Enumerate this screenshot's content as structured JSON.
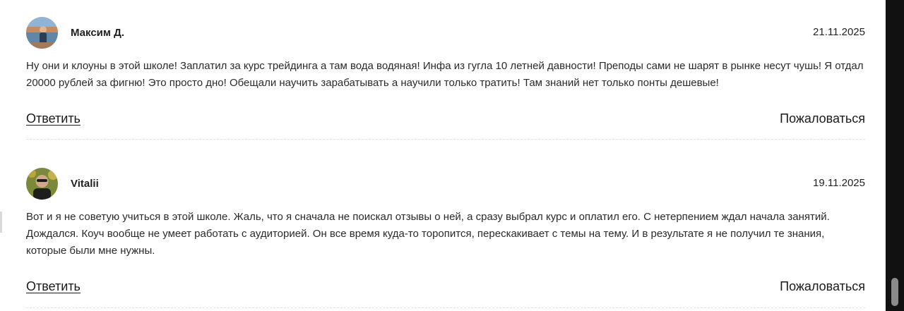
{
  "reviews": [
    {
      "author": "Максим Д.",
      "date": "21.11.2025",
      "text": "Ну они и клоуны в этой школе! Заплатил за курс трейдинга а там вода водяная! Инфа из гугла 10 летней давности! Преподы сами не шарят в рынке несут чушь! Я отдал 20000 рублей за фигню! Это просто дно! Обещали научить зарабатывать а научили только тратить! Там знаний нет только понты дешевые!",
      "reply_label": "Ответить",
      "report_label": "Пожаловаться",
      "avatar": "photo-avatar-landscape"
    },
    {
      "author": "Vitalii",
      "date": "19.11.2025",
      "text": "Вот и я не советую учиться в этой школе. Жаль, что я сначала не поискал отзывы о ней, а сразу выбрал курс и оплатил его. С нетерпением ждал начала занятий. Дождался. Коуч вообще не умеет работать с аудиторией. Он все время куда-то торопится, перескакивает с темы на тему. И в результате я не получил те знания, которые были мне нужны.",
      "reply_label": "Ответить",
      "report_label": "Пожаловаться",
      "avatar": "photo-avatar-sunglasses"
    }
  ],
  "colors": {
    "text": "#2a2a2a",
    "divider": "#e2e2e2",
    "scrollbar": "#111111",
    "scroll_thumb": "#8a8a8a"
  }
}
